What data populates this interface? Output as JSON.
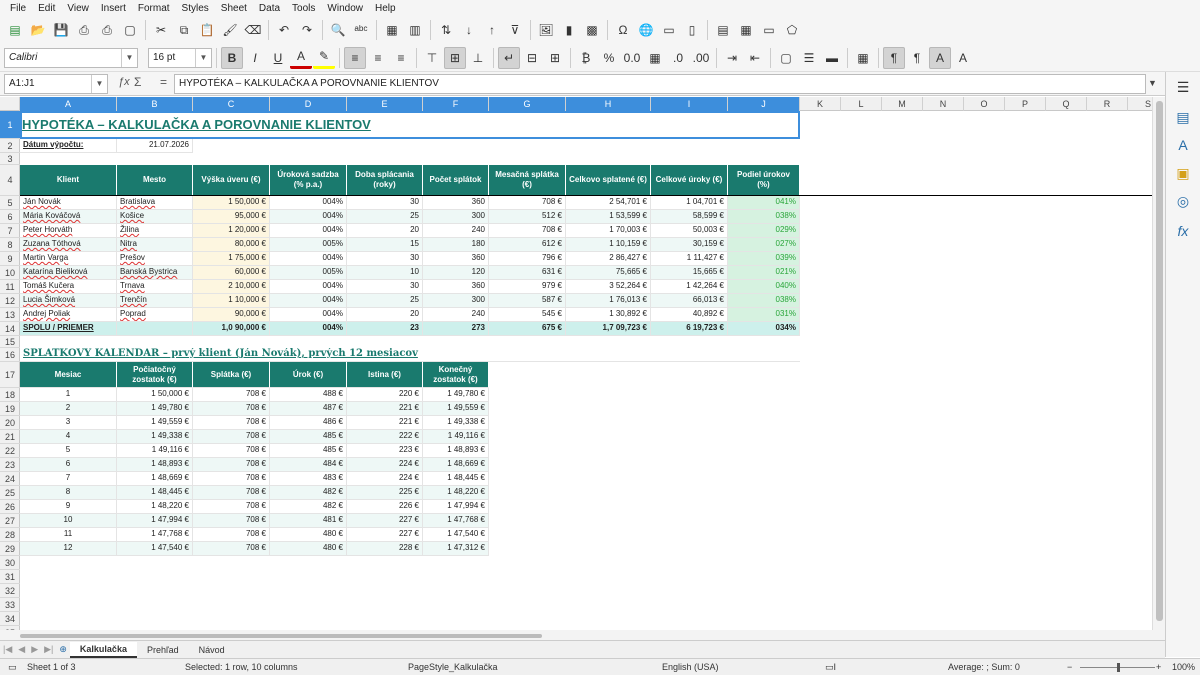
{
  "menu": [
    "File",
    "Edit",
    "View",
    "Insert",
    "Format",
    "Styles",
    "Sheet",
    "Data",
    "Tools",
    "Window",
    "Help"
  ],
  "toolbar": {
    "font_name": "Calibri",
    "font_size": "16 pt",
    "icons1": [
      "new-icon",
      "open-icon",
      "save-icon",
      "export-pdf-icon",
      "print-icon",
      "print-preview-icon",
      "cut-icon",
      "copy-icon",
      "paste-icon",
      "clone-icon",
      "clear-icon",
      "undo-icon",
      "redo-icon",
      "find-icon",
      "spellcheck-icon",
      "row-icon",
      "column-icon",
      "sort-icon",
      "sort-asc-icon",
      "sort-desc-icon",
      "autofilter-icon",
      "image-icon",
      "chart-icon",
      "pivot-icon",
      "special-char-icon",
      "hyperlink-icon",
      "comment-icon",
      "header-footer-icon",
      "define-print-area-icon",
      "freeze-icon",
      "split-icon",
      "show-draw-icon"
    ],
    "icons2": [
      "bold-icon",
      "italic-icon",
      "underline-icon",
      "font-color-icon",
      "highlight-icon",
      "align-left-icon",
      "align-center-icon",
      "align-right-icon",
      "align-top-icon",
      "align-middle-icon",
      "align-bottom-icon",
      "wrap-icon",
      "merge-icon",
      "unmerge-icon",
      "currency-icon",
      "percent-icon",
      "decimal-icon",
      "date-icon",
      "add-decimal-icon",
      "delete-decimal-icon",
      "indent-icon",
      "outdent-icon",
      "borders-icon",
      "border-style-icon",
      "border-color-icon",
      "conditional-icon",
      "ltr-icon",
      "rtl-icon",
      "text-ltr-icon",
      "text-ttb-icon"
    ]
  },
  "formula": {
    "name_box": "A1:J1",
    "content": "HYPOTÉKA – KALKULAČKA A POROVNANIE KLIENTOV"
  },
  "columns": [
    "A",
    "B",
    "C",
    "D",
    "E",
    "F",
    "G",
    "H",
    "I",
    "J",
    "K",
    "L",
    "M",
    "N",
    "O",
    "P",
    "Q",
    "R",
    "S"
  ],
  "sheet": {
    "title": "HYPOTÉKA – KALKULAČKA A POROVNANIE KLIENTOV",
    "date_label": "Dátum výpočtu:",
    "date_value": "21.07.2026",
    "headers": [
      "Klient",
      "Mesto",
      "Výška úveru (€)",
      "Úroková sadzba (% p.a.)",
      "Doba splácania (roky)",
      "Počet splátok",
      "Mesačná splátka (€)",
      "Celkovo splatené (€)",
      "Celkové úroky (€)",
      "Podiel úrokov (%)"
    ],
    "clients": [
      [
        "Ján Novák",
        "Bratislava",
        "1 50,000 €",
        "004%",
        "30",
        "360",
        "708 €",
        "2 54,701 €",
        "1 04,701 €",
        "041%"
      ],
      [
        "Mária Kováčová",
        "Košice",
        "95,000 €",
        "004%",
        "25",
        "300",
        "512 €",
        "1 53,599 €",
        "58,599 €",
        "038%"
      ],
      [
        "Peter Horváth",
        "Žilina",
        "1 20,000 €",
        "004%",
        "20",
        "240",
        "708 €",
        "1 70,003 €",
        "50,003 €",
        "029%"
      ],
      [
        "Zuzana Tóthová",
        "Nitra",
        "80,000 €",
        "005%",
        "15",
        "180",
        "612 €",
        "1 10,159 €",
        "30,159 €",
        "027%"
      ],
      [
        "Martin Varga",
        "Prešov",
        "1 75,000 €",
        "004%",
        "30",
        "360",
        "796 €",
        "2 86,427 €",
        "1 11,427 €",
        "039%"
      ],
      [
        "Katarína Bieliková",
        "Banská Bystrica",
        "60,000 €",
        "005%",
        "10",
        "120",
        "631 €",
        "75,665 €",
        "15,665 €",
        "021%"
      ],
      [
        "Tomáš Kučera",
        "Trnava",
        "2 10,000 €",
        "004%",
        "30",
        "360",
        "979 €",
        "3 52,264 €",
        "1 42,264 €",
        "040%"
      ],
      [
        "Lucia Šimková",
        "Trenčín",
        "1 10,000 €",
        "004%",
        "25",
        "300",
        "587 €",
        "1 76,013 €",
        "66,013 €",
        "038%"
      ],
      [
        "Andrej Poliak",
        "Poprad",
        "90,000 €",
        "004%",
        "20",
        "240",
        "545 €",
        "1 30,892 €",
        "40,892 €",
        "031%"
      ]
    ],
    "total": [
      "SPOLU / PRIEMER",
      "",
      "1,0 90,000 €",
      "004%",
      "23",
      "273",
      "675 €",
      "1,7 09,723 €",
      "6 19,723 €",
      "034%"
    ],
    "section_title": "SPLÁTKOVÝ KALENDÁR – prvý klient (Ján Novák), prvých 12 mesiacov",
    "sched_headers": [
      "Mesiac",
      "Počiatočný zostatok (€)",
      "Splátka (€)",
      "Úrok (€)",
      "Istina (€)",
      "Konečný zostatok (€)"
    ],
    "schedule": [
      [
        "1",
        "1 50,000 €",
        "708 €",
        "488 €",
        "220 €",
        "1 49,780 €"
      ],
      [
        "2",
        "1 49,780 €",
        "708 €",
        "487 €",
        "221 €",
        "1 49,559 €"
      ],
      [
        "3",
        "1 49,559 €",
        "708 €",
        "486 €",
        "221 €",
        "1 49,338 €"
      ],
      [
        "4",
        "1 49,338 €",
        "708 €",
        "485 €",
        "222 €",
        "1 49,116 €"
      ],
      [
        "5",
        "1 49,116 €",
        "708 €",
        "485 €",
        "223 €",
        "1 48,893 €"
      ],
      [
        "6",
        "1 48,893 €",
        "708 €",
        "484 €",
        "224 €",
        "1 48,669 €"
      ],
      [
        "7",
        "1 48,669 €",
        "708 €",
        "483 €",
        "224 €",
        "1 48,445 €"
      ],
      [
        "8",
        "1 48,445 €",
        "708 €",
        "482 €",
        "225 €",
        "1 48,220 €"
      ],
      [
        "9",
        "1 48,220 €",
        "708 €",
        "482 €",
        "226 €",
        "1 47,994 €"
      ],
      [
        "10",
        "1 47,994 €",
        "708 €",
        "481 €",
        "227 €",
        "1 47,768 €"
      ],
      [
        "11",
        "1 47,768 €",
        "708 €",
        "480 €",
        "227 €",
        "1 47,540 €"
      ],
      [
        "12",
        "1 47,540 €",
        "708 €",
        "480 €",
        "228 €",
        "1 47,312 €"
      ]
    ]
  },
  "tabs": [
    "Kalkulačka",
    "Prehľad",
    "Návod"
  ],
  "status": {
    "sheet": "Sheet 1 of 3",
    "selection": "Selected: 1 row, 10 columns",
    "style": "PageStyle_Kalkulačka",
    "lang": "English (USA)",
    "sum": "Average: ; Sum: 0",
    "zoom": "100%"
  }
}
